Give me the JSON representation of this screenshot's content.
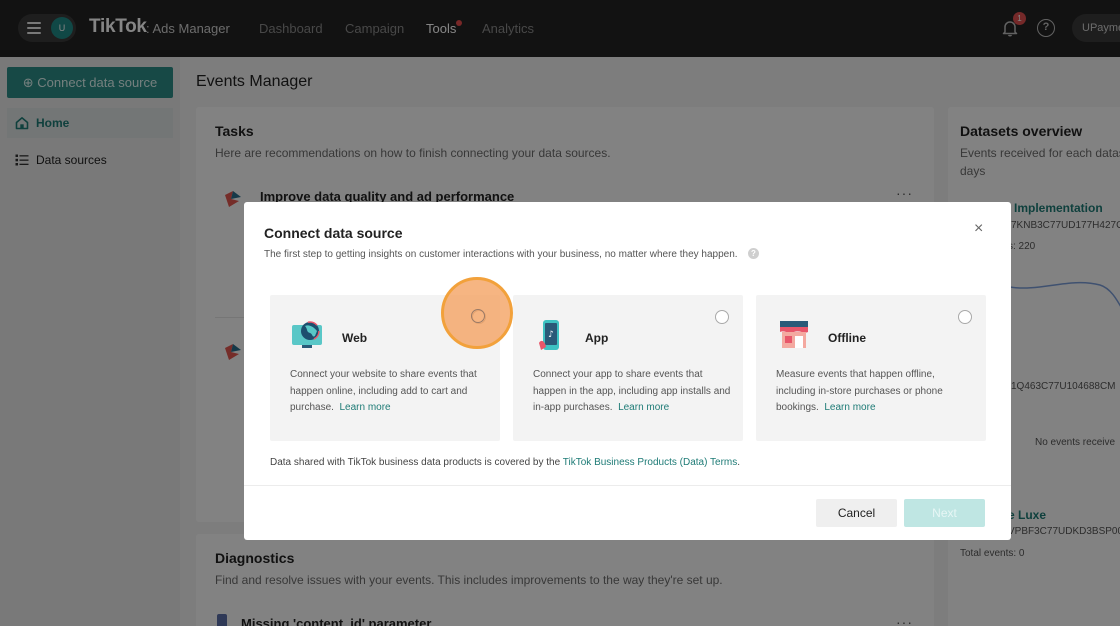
{
  "topbar": {
    "avatar_initial": "U",
    "logo": "TikTok",
    "logo_sub": ": Ads Manager",
    "nav": [
      {
        "label": "Dashboard"
      },
      {
        "label": "Campaign"
      },
      {
        "label": "Tools"
      },
      {
        "label": "Analytics"
      }
    ],
    "notification_count": "1",
    "help_glyph": "?",
    "account_label": "UPayme"
  },
  "sidebar": {
    "connect_button": "⊕ Connect data source",
    "items": [
      {
        "label": "Home",
        "icon": "home-icon"
      },
      {
        "label": "Data sources",
        "icon": "list-icon"
      }
    ]
  },
  "main": {
    "page_title": "Events Manager",
    "tasks": {
      "title": "Tasks",
      "subtitle": "Here are recommendations on how to finish connecting your data sources.",
      "item1_title": "Improve data quality and ad performance",
      "menu": "···"
    },
    "diagnostics": {
      "title": "Diagnostics",
      "subtitle": "Find and resolve issues with your events. This includes improvements to the way they're set up.",
      "item1_title": "Missing 'content_id' parameter",
      "menu": "···"
    },
    "datasets": {
      "title": "Datasets overview",
      "subtitle_line1": "Events received for each datas",
      "subtitle_line2": "days",
      "entry1_name": "Implementation",
      "entry1_id": "7KNB3C77UD177H427G",
      "entry1_count": "s: 220",
      "entry2_id": "1Q463C77U104688CM",
      "entry2_status": "No events receive",
      "entry3_name": "e Luxe",
      "entry3_id": "VPBF3C77UDKD3BSP00",
      "entry3_count": "Total events: 0"
    }
  },
  "modal": {
    "title": "Connect data source",
    "subtitle": "The first step to getting insights on customer interactions with your business, no matter where they happen.",
    "info_glyph": "?",
    "close_glyph": "×",
    "options": [
      {
        "label": "Web",
        "icon": "web-globe-icon",
        "desc": "Connect your website to share events that happen online, including add to cart and purchase.",
        "link": "Learn more"
      },
      {
        "label": "App",
        "icon": "app-phone-icon",
        "desc": "Connect your app to share events that happen in the app, including app installs and in-app purchases.",
        "link": "Learn more"
      },
      {
        "label": "Offline",
        "icon": "offline-store-icon",
        "desc": "Measure events that happen offline, including in-store purchases or phone bookings.",
        "link": "Learn more"
      }
    ],
    "terms_prefix": "Data shared with TikTok business data products is covered by the",
    "terms_link": "TikTok Business Products (Data) Terms",
    "terms_suffix": ".",
    "cancel_label": "Cancel",
    "next_label": "Next"
  },
  "colors": {
    "brand_teal": "#2c8c86",
    "link_teal": "#1e7b76",
    "next_disabled": "#bfe6e3",
    "click_highlight": "#f2a13b"
  }
}
